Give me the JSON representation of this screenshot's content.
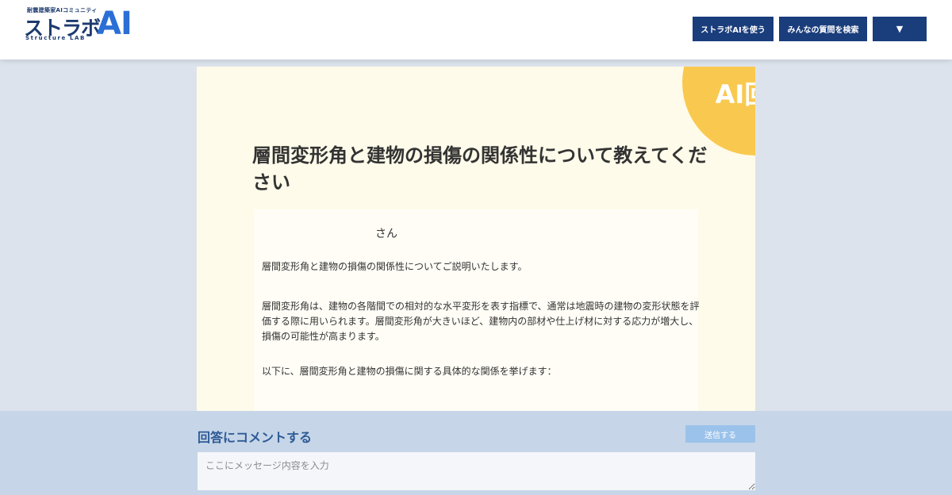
{
  "header": {
    "logo": {
      "tagline": "耐震建築家AIコミュニティ",
      "main": "ストラボ",
      "ai": "AI",
      "sub": "Structure LAB"
    },
    "nav": {
      "use_label": "ストラボAIを使う",
      "search_label": "みんなの質問を検索",
      "menu_icon": "▼"
    }
  },
  "card": {
    "badge": "AI回答",
    "question_title": "層間変形角と建物の損傷の関係性について教えてください",
    "greeting": "さん",
    "paragraphs": [
      "層間変形角と建物の損傷の関係性についてご説明いたします。",
      "層間変形角は、建物の各階間での相対的な水平変形を表す指標で、通常は地震時の建物の変形状態を評価する際に用いられます。層間変形角が大きいほど、建物内の部材や仕上げ材に対する応力が増大し、損傷の可能性が高まります。",
      "以下に、層間変形角と建物の損傷に関する具体的な関係を挙げます："
    ]
  },
  "comment": {
    "title": "回答にコメントする",
    "send_label": "送信する",
    "placeholder": "ここにメッセージ内容を入力"
  },
  "colors": {
    "nav_button": "#1a3d7c",
    "badge": "#f9c94f",
    "card_background": "#fffbea",
    "send_button": "#9bc2ea"
  }
}
